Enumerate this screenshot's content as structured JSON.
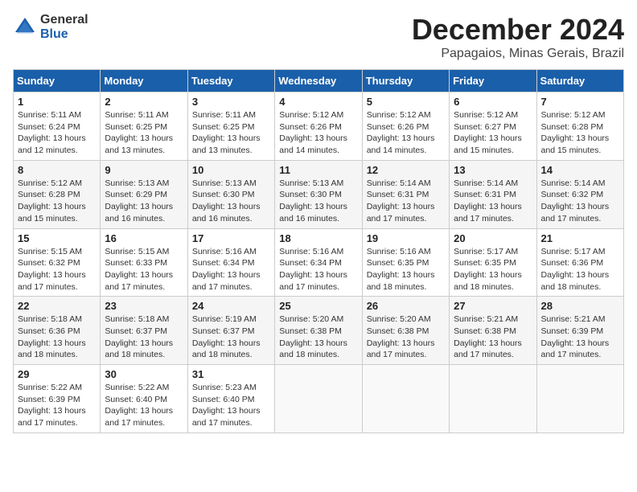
{
  "logo": {
    "general": "General",
    "blue": "Blue"
  },
  "title": "December 2024",
  "location": "Papagaios, Minas Gerais, Brazil",
  "days_of_week": [
    "Sunday",
    "Monday",
    "Tuesday",
    "Wednesday",
    "Thursday",
    "Friday",
    "Saturday"
  ],
  "weeks": [
    [
      {
        "day": "1",
        "sunrise": "5:11 AM",
        "sunset": "6:24 PM",
        "daylight": "13 hours and 12 minutes."
      },
      {
        "day": "2",
        "sunrise": "5:11 AM",
        "sunset": "6:25 PM",
        "daylight": "13 hours and 13 minutes."
      },
      {
        "day": "3",
        "sunrise": "5:11 AM",
        "sunset": "6:25 PM",
        "daylight": "13 hours and 13 minutes."
      },
      {
        "day": "4",
        "sunrise": "5:12 AM",
        "sunset": "6:26 PM",
        "daylight": "13 hours and 14 minutes."
      },
      {
        "day": "5",
        "sunrise": "5:12 AM",
        "sunset": "6:26 PM",
        "daylight": "13 hours and 14 minutes."
      },
      {
        "day": "6",
        "sunrise": "5:12 AM",
        "sunset": "6:27 PM",
        "daylight": "13 hours and 15 minutes."
      },
      {
        "day": "7",
        "sunrise": "5:12 AM",
        "sunset": "6:28 PM",
        "daylight": "13 hours and 15 minutes."
      }
    ],
    [
      {
        "day": "8",
        "sunrise": "5:12 AM",
        "sunset": "6:28 PM",
        "daylight": "13 hours and 15 minutes."
      },
      {
        "day": "9",
        "sunrise": "5:13 AM",
        "sunset": "6:29 PM",
        "daylight": "13 hours and 16 minutes."
      },
      {
        "day": "10",
        "sunrise": "5:13 AM",
        "sunset": "6:30 PM",
        "daylight": "13 hours and 16 minutes."
      },
      {
        "day": "11",
        "sunrise": "5:13 AM",
        "sunset": "6:30 PM",
        "daylight": "13 hours and 16 minutes."
      },
      {
        "day": "12",
        "sunrise": "5:14 AM",
        "sunset": "6:31 PM",
        "daylight": "13 hours and 17 minutes."
      },
      {
        "day": "13",
        "sunrise": "5:14 AM",
        "sunset": "6:31 PM",
        "daylight": "13 hours and 17 minutes."
      },
      {
        "day": "14",
        "sunrise": "5:14 AM",
        "sunset": "6:32 PM",
        "daylight": "13 hours and 17 minutes."
      }
    ],
    [
      {
        "day": "15",
        "sunrise": "5:15 AM",
        "sunset": "6:32 PM",
        "daylight": "13 hours and 17 minutes."
      },
      {
        "day": "16",
        "sunrise": "5:15 AM",
        "sunset": "6:33 PM",
        "daylight": "13 hours and 17 minutes."
      },
      {
        "day": "17",
        "sunrise": "5:16 AM",
        "sunset": "6:34 PM",
        "daylight": "13 hours and 17 minutes."
      },
      {
        "day": "18",
        "sunrise": "5:16 AM",
        "sunset": "6:34 PM",
        "daylight": "13 hours and 17 minutes."
      },
      {
        "day": "19",
        "sunrise": "5:16 AM",
        "sunset": "6:35 PM",
        "daylight": "13 hours and 18 minutes."
      },
      {
        "day": "20",
        "sunrise": "5:17 AM",
        "sunset": "6:35 PM",
        "daylight": "13 hours and 18 minutes."
      },
      {
        "day": "21",
        "sunrise": "5:17 AM",
        "sunset": "6:36 PM",
        "daylight": "13 hours and 18 minutes."
      }
    ],
    [
      {
        "day": "22",
        "sunrise": "5:18 AM",
        "sunset": "6:36 PM",
        "daylight": "13 hours and 18 minutes."
      },
      {
        "day": "23",
        "sunrise": "5:18 AM",
        "sunset": "6:37 PM",
        "daylight": "13 hours and 18 minutes."
      },
      {
        "day": "24",
        "sunrise": "5:19 AM",
        "sunset": "6:37 PM",
        "daylight": "13 hours and 18 minutes."
      },
      {
        "day": "25",
        "sunrise": "5:20 AM",
        "sunset": "6:38 PM",
        "daylight": "13 hours and 18 minutes."
      },
      {
        "day": "26",
        "sunrise": "5:20 AM",
        "sunset": "6:38 PM",
        "daylight": "13 hours and 17 minutes."
      },
      {
        "day": "27",
        "sunrise": "5:21 AM",
        "sunset": "6:38 PM",
        "daylight": "13 hours and 17 minutes."
      },
      {
        "day": "28",
        "sunrise": "5:21 AM",
        "sunset": "6:39 PM",
        "daylight": "13 hours and 17 minutes."
      }
    ],
    [
      {
        "day": "29",
        "sunrise": "5:22 AM",
        "sunset": "6:39 PM",
        "daylight": "13 hours and 17 minutes."
      },
      {
        "day": "30",
        "sunrise": "5:22 AM",
        "sunset": "6:40 PM",
        "daylight": "13 hours and 17 minutes."
      },
      {
        "day": "31",
        "sunrise": "5:23 AM",
        "sunset": "6:40 PM",
        "daylight": "13 hours and 17 minutes."
      },
      null,
      null,
      null,
      null
    ]
  ]
}
